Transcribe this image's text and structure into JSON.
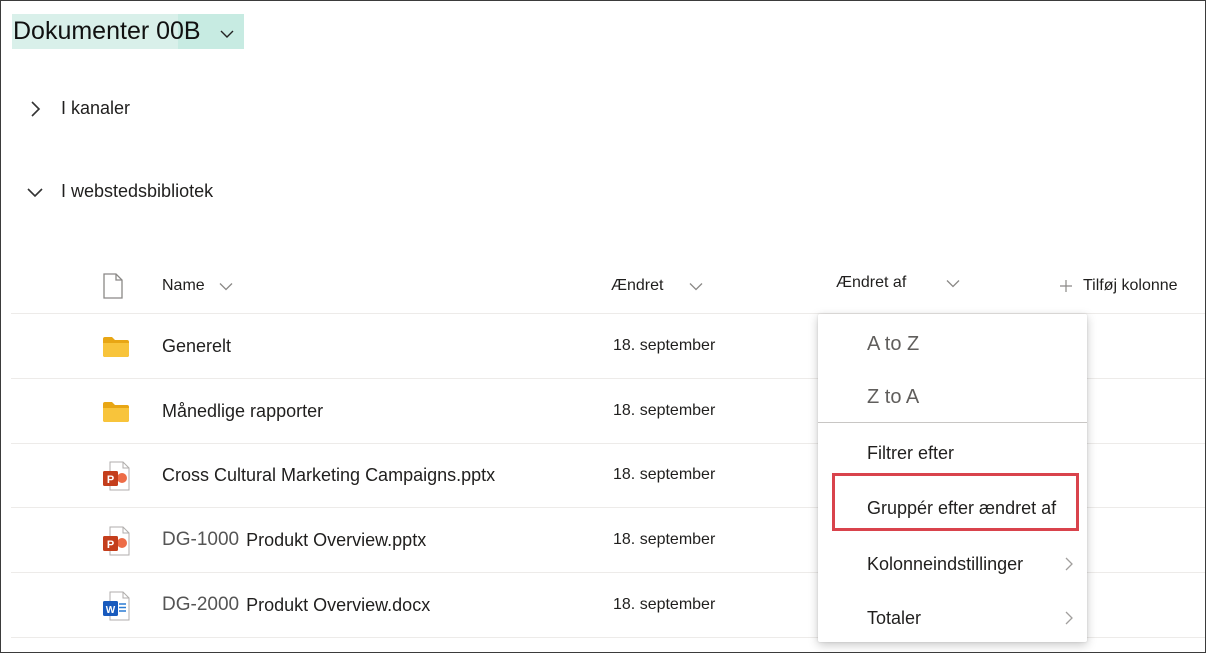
{
  "title": {
    "text": "Dokumenter 00B"
  },
  "sections": [
    {
      "label": "I kanaler",
      "expanded": false
    },
    {
      "label": "I webstedsbibliotek",
      "expanded": true
    }
  ],
  "table": {
    "columns": {
      "name": "Name",
      "modified": "Ændret",
      "modified_by": "Ændret af",
      "add_column": "Tilføj kolonne"
    },
    "rows": [
      {
        "icon": "folder-icon",
        "prefix": "",
        "name": "Generelt",
        "date": "18. september"
      },
      {
        "icon": "folder-icon",
        "prefix": "",
        "name": "Månedlige rapporter",
        "date": "18. september"
      },
      {
        "icon": "powerpoint-icon",
        "prefix": "",
        "name": "Cross Cultural Marketing Campaigns.pptx",
        "date": "18. september"
      },
      {
        "icon": "powerpoint-icon",
        "prefix": "DG-1000",
        "name": "Produkt Overview.pptx",
        "date": "18. september"
      },
      {
        "icon": "word-icon",
        "prefix": "DG-2000",
        "name": "Produkt Overview.docx",
        "date": "18. september"
      }
    ]
  },
  "menu": {
    "items": [
      {
        "label": "A to Z",
        "submenu": false
      },
      {
        "label": "Z to A",
        "submenu": false
      },
      {
        "label": "Filtrer efter",
        "submenu": false
      },
      {
        "label": "Gruppér efter ændret af",
        "submenu": false,
        "highlighted": true
      },
      {
        "label": "Kolonneindstillinger",
        "submenu": true
      },
      {
        "label": "Totaler",
        "submenu": true
      }
    ]
  },
  "colors": {
    "title_highlight": "#c7ebe2",
    "folder": "#f8c43b",
    "powerpoint": "#c43e1c",
    "word": "#185abd",
    "callout_border": "#d9434c"
  }
}
